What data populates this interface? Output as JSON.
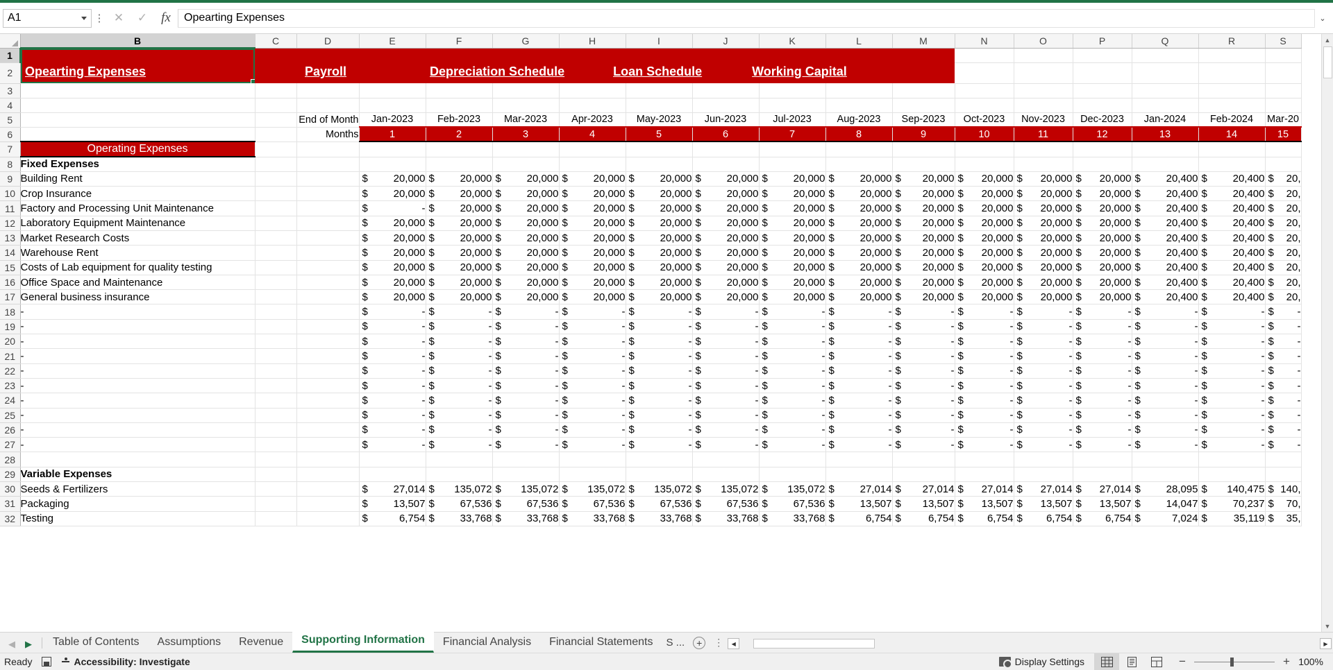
{
  "formula_bar": {
    "name_box": "A1",
    "formula_value": "Opearting Expenses",
    "cancel_icon": "✕",
    "confirm_icon": "✓",
    "fx_icon": "fx",
    "expand_icon": "⌄"
  },
  "columns": [
    "B",
    "C",
    "D",
    "E",
    "F",
    "G",
    "H",
    "I",
    "J",
    "K",
    "L",
    "M",
    "N",
    "O",
    "P",
    "Q",
    "R",
    "S"
  ],
  "selected_column": "B",
  "selected_row": 1,
  "row_numbers": [
    1,
    2,
    3,
    4,
    5,
    6,
    7,
    8,
    9,
    10,
    11,
    12,
    13,
    14,
    15,
    16,
    17,
    18,
    19,
    20,
    21,
    22,
    23,
    24,
    25,
    26,
    27,
    28,
    29,
    30,
    31,
    32
  ],
  "nav_links": [
    {
      "label": "Opearting Expenses",
      "col": "B",
      "selected": true
    },
    {
      "label": "Payroll",
      "col": "D",
      "selected": false
    },
    {
      "label": "Depreciation Schedule",
      "col": "G",
      "selected": false
    },
    {
      "label": "Loan Schedule",
      "col": "I",
      "selected": false
    },
    {
      "label": "Working Capital",
      "col": "M",
      "selected": false
    }
  ],
  "headers": {
    "end_of_month_label": "End of Month",
    "months_label": "Months",
    "dates": [
      "Jan-2023",
      "Feb-2023",
      "Mar-2023",
      "Apr-2023",
      "May-2023",
      "Jun-2023",
      "Jul-2023",
      "Aug-2023",
      "Sep-2023",
      "Oct-2023",
      "Nov-2023",
      "Dec-2023",
      "Jan-2024",
      "Feb-2024",
      "Mar-20"
    ],
    "month_numbers": [
      "1",
      "2",
      "3",
      "4",
      "5",
      "6",
      "7",
      "8",
      "9",
      "10",
      "11",
      "12",
      "13",
      "14",
      "15"
    ]
  },
  "section_banner": "Operating Expenses",
  "sections": {
    "fixed_title": "Fixed Expenses",
    "variable_title": "Variable Expenses"
  },
  "currency_symbol": "$",
  "dash": "-",
  "rows": [
    {
      "row": 7,
      "type": "banner",
      "label": "Operating Expenses"
    },
    {
      "row": 8,
      "type": "section",
      "label": "Fixed Expenses"
    },
    {
      "row": 9,
      "type": "data",
      "label": "Building Rent",
      "values": [
        "20,000",
        "20,000",
        "20,000",
        "20,000",
        "20,000",
        "20,000",
        "20,000",
        "20,000",
        "20,000",
        "20,000",
        "20,000",
        "20,000",
        "20,400",
        "20,400",
        "20,"
      ]
    },
    {
      "row": 10,
      "type": "data",
      "label": "Crop Insurance",
      "values": [
        "20,000",
        "20,000",
        "20,000",
        "20,000",
        "20,000",
        "20,000",
        "20,000",
        "20,000",
        "20,000",
        "20,000",
        "20,000",
        "20,000",
        "20,400",
        "20,400",
        "20,"
      ]
    },
    {
      "row": 11,
      "type": "data",
      "label": "Factory and Processing Unit Maintenance",
      "values": [
        "-",
        "20,000",
        "20,000",
        "20,000",
        "20,000",
        "20,000",
        "20,000",
        "20,000",
        "20,000",
        "20,000",
        "20,000",
        "20,000",
        "20,400",
        "20,400",
        "20,"
      ]
    },
    {
      "row": 12,
      "type": "data",
      "label": "Laboratory Equipment Maintenance",
      "values": [
        "20,000",
        "20,000",
        "20,000",
        "20,000",
        "20,000",
        "20,000",
        "20,000",
        "20,000",
        "20,000",
        "20,000",
        "20,000",
        "20,000",
        "20,400",
        "20,400",
        "20,"
      ]
    },
    {
      "row": 13,
      "type": "data",
      "label": "Market Research Costs",
      "values": [
        "20,000",
        "20,000",
        "20,000",
        "20,000",
        "20,000",
        "20,000",
        "20,000",
        "20,000",
        "20,000",
        "20,000",
        "20,000",
        "20,000",
        "20,400",
        "20,400",
        "20,"
      ]
    },
    {
      "row": 14,
      "type": "data",
      "label": "Warehouse Rent",
      "values": [
        "20,000",
        "20,000",
        "20,000",
        "20,000",
        "20,000",
        "20,000",
        "20,000",
        "20,000",
        "20,000",
        "20,000",
        "20,000",
        "20,000",
        "20,400",
        "20,400",
        "20,"
      ]
    },
    {
      "row": 15,
      "type": "data",
      "label": "Costs of Lab equipment for quality testing",
      "values": [
        "20,000",
        "20,000",
        "20,000",
        "20,000",
        "20,000",
        "20,000",
        "20,000",
        "20,000",
        "20,000",
        "20,000",
        "20,000",
        "20,000",
        "20,400",
        "20,400",
        "20,"
      ]
    },
    {
      "row": 16,
      "type": "data",
      "label": "Office Space and Maintenance",
      "values": [
        "20,000",
        "20,000",
        "20,000",
        "20,000",
        "20,000",
        "20,000",
        "20,000",
        "20,000",
        "20,000",
        "20,000",
        "20,000",
        "20,000",
        "20,400",
        "20,400",
        "20,"
      ]
    },
    {
      "row": 17,
      "type": "data",
      "label": "General business insurance",
      "values": [
        "20,000",
        "20,000",
        "20,000",
        "20,000",
        "20,000",
        "20,000",
        "20,000",
        "20,000",
        "20,000",
        "20,000",
        "20,000",
        "20,000",
        "20,400",
        "20,400",
        "20,"
      ]
    },
    {
      "row": 18,
      "type": "data",
      "label": "-",
      "values": [
        "-",
        "-",
        "-",
        "-",
        "-",
        "-",
        "-",
        "-",
        "-",
        "-",
        "-",
        "-",
        "-",
        "-",
        "-"
      ]
    },
    {
      "row": 19,
      "type": "data",
      "label": "-",
      "values": [
        "-",
        "-",
        "-",
        "-",
        "-",
        "-",
        "-",
        "-",
        "-",
        "-",
        "-",
        "-",
        "-",
        "-",
        "-"
      ]
    },
    {
      "row": 20,
      "type": "data",
      "label": "-",
      "values": [
        "-",
        "-",
        "-",
        "-",
        "-",
        "-",
        "-",
        "-",
        "-",
        "-",
        "-",
        "-",
        "-",
        "-",
        "-"
      ]
    },
    {
      "row": 21,
      "type": "data",
      "label": "-",
      "values": [
        "-",
        "-",
        "-",
        "-",
        "-",
        "-",
        "-",
        "-",
        "-",
        "-",
        "-",
        "-",
        "-",
        "-",
        "-"
      ]
    },
    {
      "row": 22,
      "type": "data",
      "label": "-",
      "values": [
        "-",
        "-",
        "-",
        "-",
        "-",
        "-",
        "-",
        "-",
        "-",
        "-",
        "-",
        "-",
        "-",
        "-",
        "-"
      ]
    },
    {
      "row": 23,
      "type": "data",
      "label": "-",
      "values": [
        "-",
        "-",
        "-",
        "-",
        "-",
        "-",
        "-",
        "-",
        "-",
        "-",
        "-",
        "-",
        "-",
        "-",
        "-"
      ]
    },
    {
      "row": 24,
      "type": "data",
      "label": "-",
      "values": [
        "-",
        "-",
        "-",
        "-",
        "-",
        "-",
        "-",
        "-",
        "-",
        "-",
        "-",
        "-",
        "-",
        "-",
        "-"
      ]
    },
    {
      "row": 25,
      "type": "data",
      "label": "-",
      "values": [
        "-",
        "-",
        "-",
        "-",
        "-",
        "-",
        "-",
        "-",
        "-",
        "-",
        "-",
        "-",
        "-",
        "-",
        "-"
      ]
    },
    {
      "row": 26,
      "type": "data",
      "label": "-",
      "values": [
        "-",
        "-",
        "-",
        "-",
        "-",
        "-",
        "-",
        "-",
        "-",
        "-",
        "-",
        "-",
        "-",
        "-",
        "-"
      ]
    },
    {
      "row": 27,
      "type": "data",
      "label": "-",
      "values": [
        "-",
        "-",
        "-",
        "-",
        "-",
        "-",
        "-",
        "-",
        "-",
        "-",
        "-",
        "-",
        "-",
        "-",
        "-"
      ]
    },
    {
      "row": 28,
      "type": "blank",
      "label": "",
      "values": []
    },
    {
      "row": 29,
      "type": "section",
      "label": "Variable Expenses"
    },
    {
      "row": 30,
      "type": "data",
      "label": "Seeds & Fertilizers",
      "values": [
        "27,014",
        "135,072",
        "135,072",
        "135,072",
        "135,072",
        "135,072",
        "135,072",
        "27,014",
        "27,014",
        "27,014",
        "27,014",
        "27,014",
        "28,095",
        "140,475",
        "140,"
      ]
    },
    {
      "row": 31,
      "type": "data",
      "label": "Packaging",
      "values": [
        "13,507",
        "67,536",
        "67,536",
        "67,536",
        "67,536",
        "67,536",
        "67,536",
        "13,507",
        "13,507",
        "13,507",
        "13,507",
        "13,507",
        "14,047",
        "70,237",
        "70,"
      ]
    },
    {
      "row": 32,
      "type": "data",
      "label": "Testing",
      "values": [
        "6,754",
        "33,768",
        "33,768",
        "33,768",
        "33,768",
        "33,768",
        "33,768",
        "6,754",
        "6,754",
        "6,754",
        "6,754",
        "6,754",
        "7,024",
        "35,119",
        "35,"
      ]
    }
  ],
  "sheet_tabs": [
    {
      "label": "Table of Contents",
      "active": false
    },
    {
      "label": "Assumptions",
      "active": false
    },
    {
      "label": "Revenue",
      "active": false
    },
    {
      "label": "Supporting Information",
      "active": true
    },
    {
      "label": "Financial Analysis",
      "active": false
    },
    {
      "label": "Financial Statements",
      "active": false
    }
  ],
  "tab_overflow_label": "S ...",
  "tab_add_label": "+",
  "tab_nav": {
    "prev": "◀",
    "next": "▶"
  },
  "status_bar": {
    "ready": "Ready",
    "accessibility": "Accessibility: Investigate",
    "display_settings": "Display Settings",
    "zoom": "100%",
    "zoom_minus": "−",
    "zoom_plus": "+"
  },
  "colors": {
    "accent_red": "#C00000",
    "excel_green": "#217346",
    "header_grey": "#f5f5f5"
  }
}
